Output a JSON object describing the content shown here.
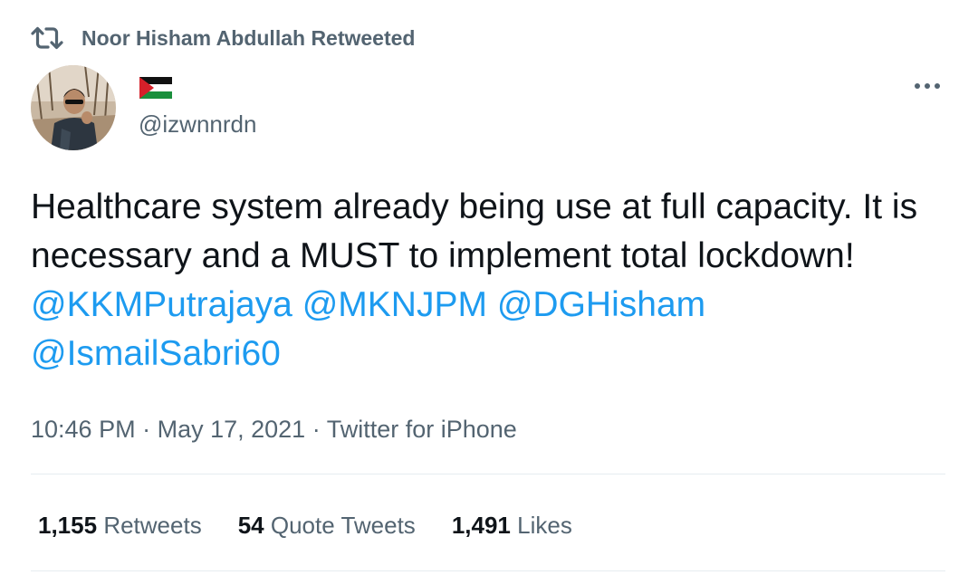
{
  "retweet_header": {
    "icon": "retweet-icon",
    "text": "Noor Hisham Abdullah Retweeted"
  },
  "author": {
    "display_name_emoji": "palestine-flag",
    "handle": "@izwnnrdn"
  },
  "tweet": {
    "text_plain": "Healthcare system already being use at full capacity. It is necessary and a MUST to implement total lockdown! ",
    "mentions": [
      "@KKMPutrajaya",
      "@MKNJPM",
      "@DGHisham",
      "@IsmailSabri60"
    ]
  },
  "meta": {
    "time": "10:46 PM",
    "separator": " · ",
    "date": "May 17, 2021",
    "source": "Twitter for iPhone"
  },
  "stats": [
    {
      "count": "1,155",
      "label": "Retweets"
    },
    {
      "count": "54",
      "label": "Quote Tweets"
    },
    {
      "count": "1,491",
      "label": "Likes"
    }
  ],
  "colors": {
    "text": "#0f1419",
    "secondary": "#536471",
    "link": "#1d9bf0",
    "divider": "#e6ecf0"
  }
}
